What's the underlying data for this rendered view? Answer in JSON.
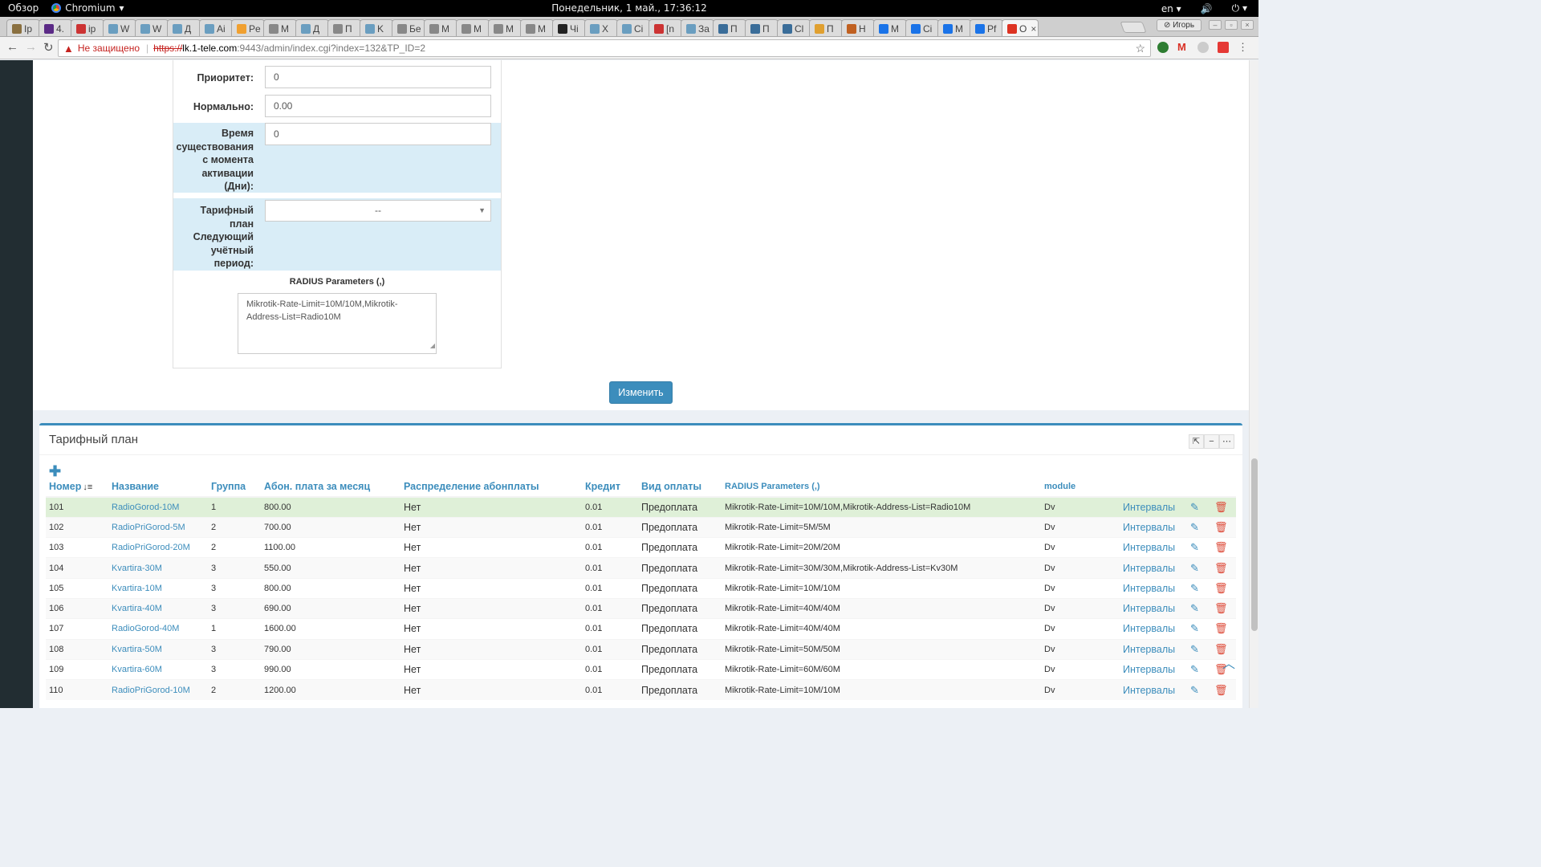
{
  "system_bar": {
    "overview": "Обзор",
    "app_name": "Chromium",
    "clock": "Понедельник,  1 май., 17:36:12",
    "lang": "en"
  },
  "browser": {
    "tabs": [
      {
        "label": "Ip",
        "color": "#8a7040"
      },
      {
        "label": "4.",
        "color": "#5b2a86"
      },
      {
        "label": "ip",
        "color": "#c33"
      },
      {
        "label": "W",
        "color": "#6a9ec0"
      },
      {
        "label": "W",
        "color": "#6a9ec0"
      },
      {
        "label": "Д",
        "color": "#6a9ec0"
      },
      {
        "label": "Ai",
        "color": "#6a9ec0"
      },
      {
        "label": "Pe",
        "color": "#f0a030"
      },
      {
        "label": "M",
        "color": "#888"
      },
      {
        "label": "Д",
        "color": "#6a9ec0"
      },
      {
        "label": "П",
        "color": "#888"
      },
      {
        "label": "K",
        "color": "#6a9ec0"
      },
      {
        "label": "Бе",
        "color": "#888"
      },
      {
        "label": "M",
        "color": "#888"
      },
      {
        "label": "M",
        "color": "#888"
      },
      {
        "label": "M",
        "color": "#888"
      },
      {
        "label": "M",
        "color": "#888"
      },
      {
        "label": "Чі",
        "color": "#222"
      },
      {
        "label": "Х",
        "color": "#6a9ec0"
      },
      {
        "label": "Сі",
        "color": "#6a9ec0"
      },
      {
        "label": "[n",
        "color": "#c33"
      },
      {
        "label": "За",
        "color": "#6a9ec0"
      },
      {
        "label": "П",
        "color": "#3a6d99"
      },
      {
        "label": "П",
        "color": "#3a6d99"
      },
      {
        "label": "Cl",
        "color": "#3a6d99"
      },
      {
        "label": "П",
        "color": "#e0a030"
      },
      {
        "label": "Н",
        "color": "#c06020"
      },
      {
        "label": "M",
        "color": "#1a73e8"
      },
      {
        "label": "Сі",
        "color": "#1a73e8"
      },
      {
        "label": "M",
        "color": "#1a73e8"
      },
      {
        "label": "Pf",
        "color": "#1a73e8"
      },
      {
        "label": "О",
        "color": "#d32"
      }
    ],
    "profile_name": "Игорь",
    "url": {
      "insecure_label": "Не защищено",
      "scheme": "https://",
      "host": "lk.1-tele.com",
      "path": ":9443/admin/index.cgi?index=132&TP_ID=2"
    }
  },
  "form": {
    "priority_label": "Приоритет:",
    "priority_value": "0",
    "normal_label": "Нормально:",
    "normal_value": "0.00",
    "lifetime_label_lines": [
      "Время",
      "существования",
      "с момента",
      "активации",
      "(Дни):"
    ],
    "lifetime_value": "0",
    "next_tp_label_lines": [
      "Тарифный",
      "план",
      "Следующий",
      "учётный",
      "период:"
    ],
    "next_tp_value": "--",
    "radius_title": "RADIUS Parameters (,)",
    "radius_value": "Mikrotik-Rate-Limit=10M/10M,Mikrotik-Address-List=Radio10M",
    "submit_label": "Изменить"
  },
  "tariff_box": {
    "title": "Тарифный план",
    "columns": [
      "Номер",
      "Название",
      "Группа",
      "Абон. плата за месяц",
      "Распределение абонплаты",
      "Кредит",
      "Вид оплаты",
      "RADIUS Parameters (,)",
      "module"
    ],
    "rows": [
      {
        "id": "101",
        "name": "RadioGorod-10M",
        "group": "1",
        "fee": "800.00",
        "dist": "Нет",
        "credit": "0.01",
        "pay": "Предоплата",
        "radius": "Mikrotik-Rate-Limit=10M/10M,Mikrotik-Address-List=Radio10M",
        "module": "Dv",
        "intervals": "Интервалы"
      },
      {
        "id": "102",
        "name": "RadioPriGorod-5M",
        "group": "2",
        "fee": "700.00",
        "dist": "Нет",
        "credit": "0.01",
        "pay": "Предоплата",
        "radius": "Mikrotik-Rate-Limit=5M/5M",
        "module": "Dv",
        "intervals": "Интервалы"
      },
      {
        "id": "103",
        "name": "RadioPriGorod-20M",
        "group": "2",
        "fee": "1100.00",
        "dist": "Нет",
        "credit": "0.01",
        "pay": "Предоплата",
        "radius": "Mikrotik-Rate-Limit=20M/20M",
        "module": "Dv",
        "intervals": "Интервалы"
      },
      {
        "id": "104",
        "name": "Kvartira-30M",
        "group": "3",
        "fee": "550.00",
        "dist": "Нет",
        "credit": "0.01",
        "pay": "Предоплата",
        "radius": "Mikrotik-Rate-Limit=30M/30M,Mikrotik-Address-List=Kv30M",
        "module": "Dv",
        "intervals": "Интервалы"
      },
      {
        "id": "105",
        "name": "Kvartira-10M",
        "group": "3",
        "fee": "800.00",
        "dist": "Нет",
        "credit": "0.01",
        "pay": "Предоплата",
        "radius": "Mikrotik-Rate-Limit=10M/10M",
        "module": "Dv",
        "intervals": "Интервалы"
      },
      {
        "id": "106",
        "name": "Kvartira-40M",
        "group": "3",
        "fee": "690.00",
        "dist": "Нет",
        "credit": "0.01",
        "pay": "Предоплата",
        "radius": "Mikrotik-Rate-Limit=40M/40M",
        "module": "Dv",
        "intervals": "Интервалы"
      },
      {
        "id": "107",
        "name": "RadioGorod-40M",
        "group": "1",
        "fee": "1600.00",
        "dist": "Нет",
        "credit": "0.01",
        "pay": "Предоплата",
        "radius": "Mikrotik-Rate-Limit=40M/40M",
        "module": "Dv",
        "intervals": "Интервалы"
      },
      {
        "id": "108",
        "name": "Kvartira-50M",
        "group": "3",
        "fee": "790.00",
        "dist": "Нет",
        "credit": "0.01",
        "pay": "Предоплата",
        "radius": "Mikrotik-Rate-Limit=50M/50M",
        "module": "Dv",
        "intervals": "Интервалы"
      },
      {
        "id": "109",
        "name": "Kvartira-60M",
        "group": "3",
        "fee": "990.00",
        "dist": "Нет",
        "credit": "0.01",
        "pay": "Предоплата",
        "radius": "Mikrotik-Rate-Limit=60M/60M",
        "module": "Dv",
        "intervals": "Интервалы"
      },
      {
        "id": "110",
        "name": "RadioPriGorod-10M",
        "group": "2",
        "fee": "1200.00",
        "dist": "Нет",
        "credit": "0.01",
        "pay": "Предоплата",
        "radius": "Mikrotik-Rate-Limit=10M/10M",
        "module": "Dv",
        "intervals": "Интервалы"
      }
    ]
  },
  "colors": {
    "accent": "#3c8dbc",
    "highlight_row": "#dff0d8",
    "danger": "#dd4b39",
    "form_highlight": "#d9edf7",
    "sidebar": "#222d32"
  }
}
